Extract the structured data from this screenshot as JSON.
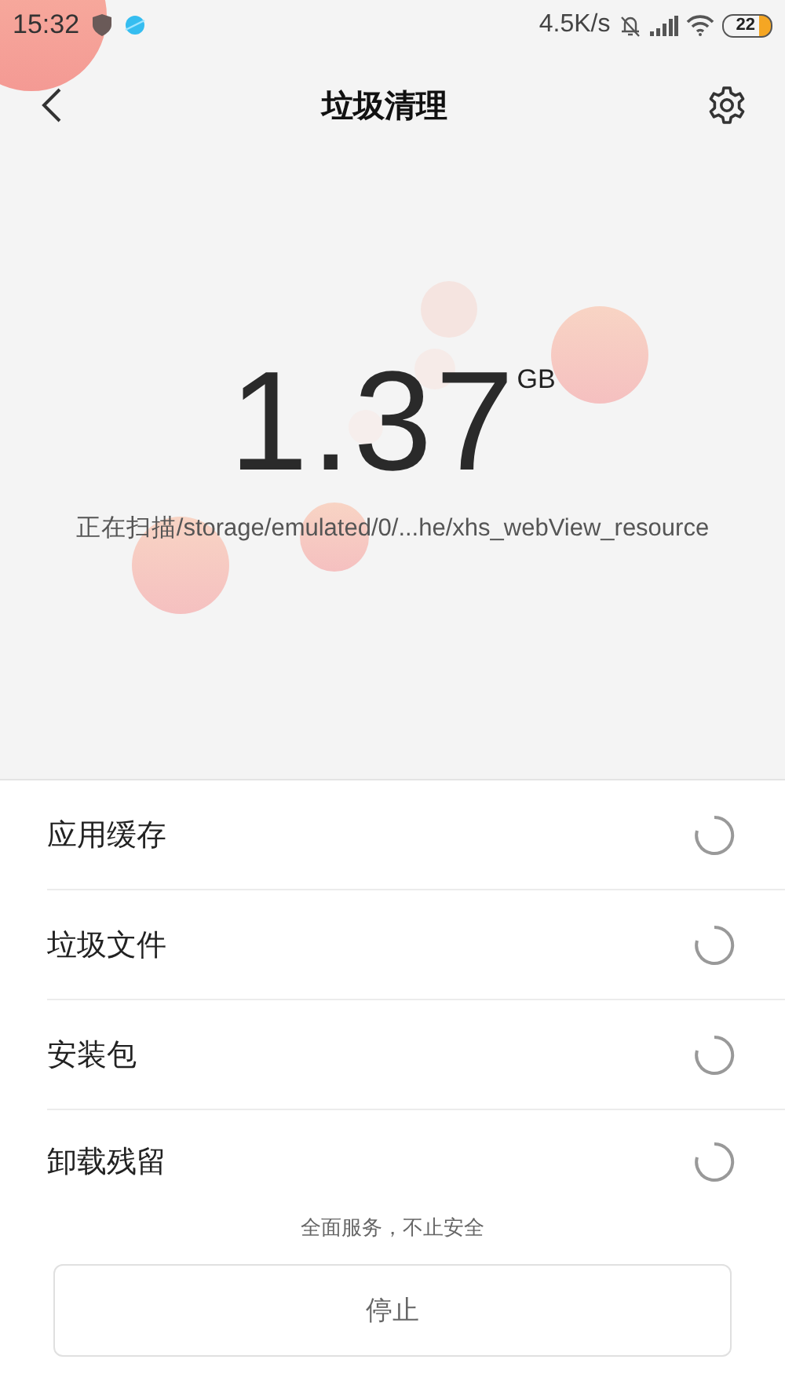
{
  "status_bar": {
    "time": "15:32",
    "speed": "4.5K/s",
    "battery": "22"
  },
  "header": {
    "title": "垃圾清理"
  },
  "scan": {
    "size": "1.37",
    "unit": "GB",
    "status": "正在扫描/storage/emulated/0/...he/xhs_webView_resource"
  },
  "categories": [
    {
      "label": "应用缓存",
      "scanning": true
    },
    {
      "label": "垃圾文件",
      "scanning": true
    },
    {
      "label": "安装包",
      "scanning": true
    },
    {
      "label": "卸载残留",
      "scanning": true
    }
  ],
  "tagline": "全面服务，不止安全",
  "stop_button": "停止"
}
